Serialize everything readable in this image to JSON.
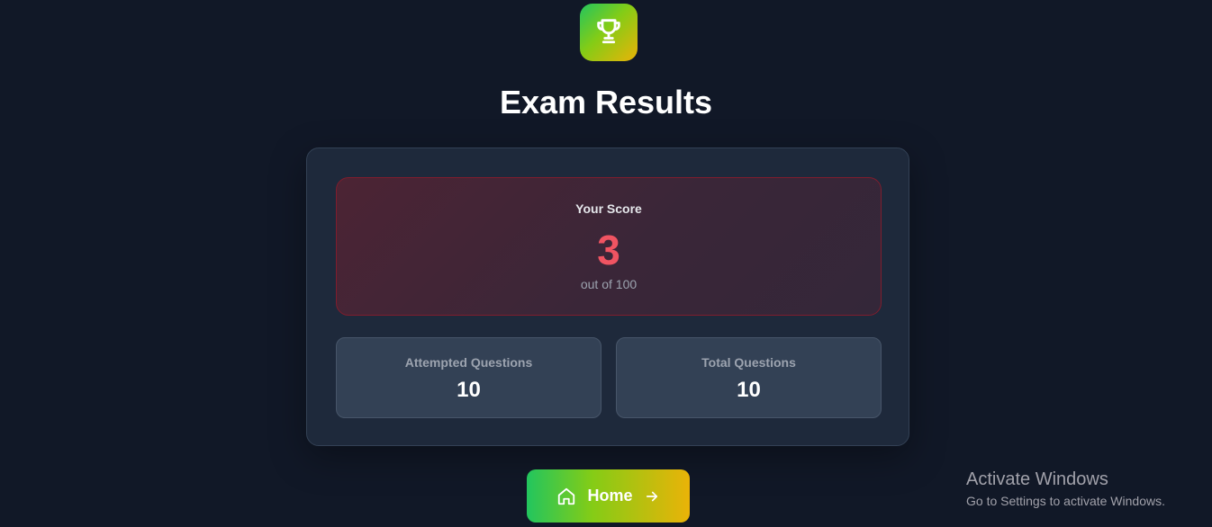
{
  "header": {
    "icon": "trophy-icon",
    "title": "Exam Results"
  },
  "score": {
    "label": "Your Score",
    "value": "3",
    "out_of": "out of 100"
  },
  "stats": [
    {
      "label": "Attempted Questions",
      "value": "10"
    },
    {
      "label": "Total Questions",
      "value": "10"
    }
  ],
  "actions": {
    "home_label": "Home",
    "home_icon": "home-icon",
    "arrow_icon": "arrow-right-icon"
  },
  "watermark": {
    "title": "Activate Windows",
    "subtitle": "Go to Settings to activate Windows."
  },
  "colors": {
    "background": "#111827",
    "card": "#1e293b",
    "score_accent": "#f05462",
    "gradient_start": "#22c55e",
    "gradient_end": "#eab308"
  }
}
